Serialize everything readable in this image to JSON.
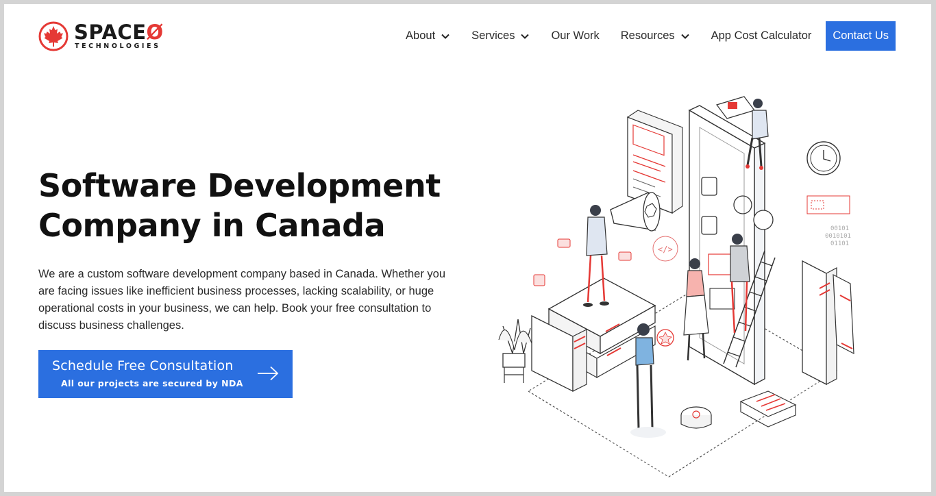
{
  "brand": {
    "name_main": "SPACE",
    "name_zero": "Ø",
    "name_sub": "TECHNOLOGIES",
    "mark_icon": "maple-leaf-icon",
    "accent_color": "#e53935"
  },
  "nav": {
    "items": [
      {
        "label": "About",
        "has_dropdown": true
      },
      {
        "label": "Services",
        "has_dropdown": true
      },
      {
        "label": "Our Work",
        "has_dropdown": false
      },
      {
        "label": "Resources",
        "has_dropdown": true
      },
      {
        "label": "App Cost Calculator",
        "has_dropdown": false
      }
    ],
    "contact_label": "Contact Us",
    "button_color": "#2b6fe0"
  },
  "hero": {
    "title_line1": "Software Development",
    "title_line2": "Company in Canada",
    "description": "We are a custom software development company based in Canada. Whether you are facing issues like inefficient business processes, lacking scalability, or huge operational costs in your business, we can help. Book your free consultation to discuss business challenges.",
    "cta_title": "Schedule Free Consultation",
    "cta_subtitle": "All our projects are secured by NDA",
    "cta_icon": "arrow-right-icon"
  },
  "illustration": {
    "icon": "isometric-team-building-app-illustration",
    "binary_lines": [
      "00101",
      "0010101",
      "01101"
    ],
    "code_tag": "</>"
  }
}
